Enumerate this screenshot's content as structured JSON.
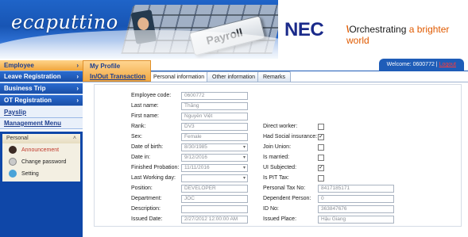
{
  "banner": {
    "logo": "ecaputtino",
    "payroll_key": "Payroll",
    "nec": "NEC",
    "tagline_pre": "Orchestrating ",
    "tagline_post": "a brighter world"
  },
  "welcome": {
    "text": "Welcome: 0600772 | ",
    "logout": "Logout"
  },
  "sidebar": {
    "items": [
      {
        "label": "Employee",
        "arrow": "›"
      },
      {
        "label": "Leave Registration",
        "arrow": "›"
      },
      {
        "label": "Business Trip",
        "arrow": "›"
      },
      {
        "label": "OT Registration",
        "arrow": "›"
      },
      {
        "label": "Payslip"
      },
      {
        "label": "Management Menu"
      }
    ],
    "personal": {
      "title": "Personal",
      "caret": "˄",
      "items": [
        "Announcement",
        "Change password",
        "Setting"
      ]
    }
  },
  "submenu": {
    "items": [
      "My Profile",
      "In/Out Transaction"
    ]
  },
  "tabs": [
    "Personal information",
    "Other information",
    "Remarks"
  ],
  "form": {
    "employee_code": {
      "label": "Employee code:",
      "value": "0600772"
    },
    "last_name": {
      "label": "Last name:",
      "value": "Thắng"
    },
    "first_name": {
      "label": "First name:",
      "value": "Nguyễn Việt"
    },
    "rank": {
      "label": "Rank:",
      "value": "DV3"
    },
    "sex": {
      "label": "Sex:",
      "value": "Female"
    },
    "date_of_birth": {
      "label": "Date of birth:",
      "value": "8/30/1985"
    },
    "date_in": {
      "label": "Date in:",
      "value": "9/12/2016"
    },
    "finished_probation": {
      "label": "Finished Probation:",
      "value": "11/11/2016"
    },
    "last_working_day": {
      "label": "Last Working day:",
      "value": ""
    },
    "position": {
      "label": "Position:",
      "value": "DEVELOPER"
    },
    "department": {
      "label": "Department:",
      "value": "JOC"
    },
    "description": {
      "label": "Description:",
      "value": ""
    },
    "issued_date": {
      "label": "Issued Date:",
      "value": "2/27/2012 12:00:00 AM"
    },
    "direct_worker": {
      "label": "Direct worker:",
      "checked": false
    },
    "had_social_insurance": {
      "label": "Had Social insurance:",
      "checked": true
    },
    "join_union": {
      "label": "Join Union:",
      "checked": false
    },
    "is_married": {
      "label": "Is married:",
      "checked": false
    },
    "ui_subjected": {
      "label": "UI Subjected:",
      "checked": true
    },
    "is_pit_tax": {
      "label": "Is PIT Tax:",
      "checked": false
    },
    "personal_tax_no": {
      "label": "Personal Tax No:",
      "value": "8417185171"
    },
    "dependent_person": {
      "label": "Dependent Person:",
      "value": "0"
    },
    "id_no": {
      "label": "ID No:",
      "value": "363847676"
    },
    "issued_place": {
      "label": "Issued Place:",
      "value": "Hậu Giang"
    }
  },
  "colors": {
    "primary_blue": "#1f5db8",
    "menu_active": "#f0a63e",
    "logout_red": "#ff3b3b",
    "tagline_orange": "#e05a00"
  },
  "icons": [
    "announcement-icon",
    "change-password-icon",
    "setting-icon",
    "chevron-right-icon",
    "collapse-caret-icon",
    "dropdown-arrow-icon",
    "checkbox-icon"
  ]
}
